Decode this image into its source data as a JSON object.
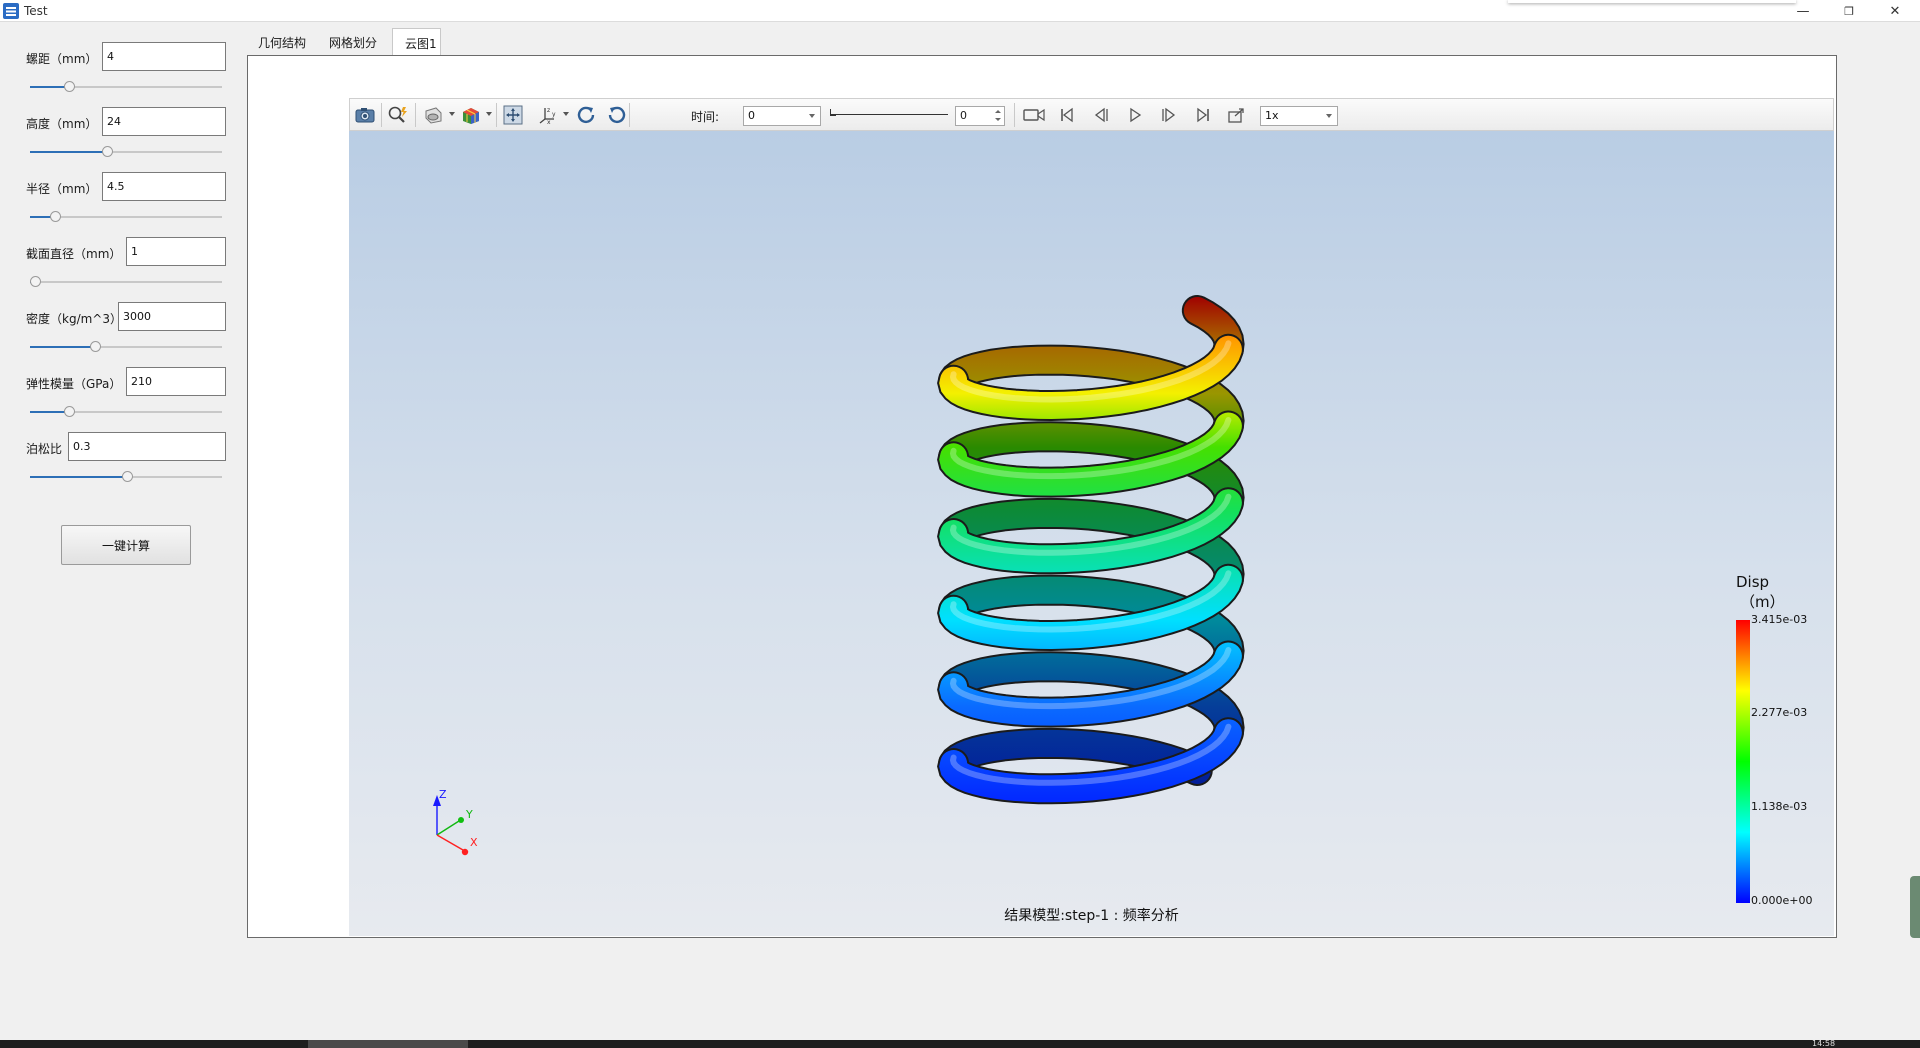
{
  "window": {
    "title": "Test",
    "minimize": "—",
    "restore": "❐",
    "close": "✕"
  },
  "params": [
    {
      "label": "螺距（mm）",
      "value": "4",
      "slider_pct": 0.19
    },
    {
      "label": "高度（mm）",
      "value": "24",
      "slider_pct": 0.4
    },
    {
      "label": "半径（mm）",
      "value": "4.5",
      "slider_pct": 0.11
    },
    {
      "label": "截面直径（mm）",
      "value": "1",
      "slider_pct": 0.0
    },
    {
      "label": "密度（kg/m^3）",
      "value": "3000",
      "slider_pct": 0.33
    },
    {
      "label": "弹性模量（GPa）",
      "value": "210",
      "slider_pct": 0.19
    },
    {
      "label": "泊松比",
      "value": "0.3",
      "slider_pct": 0.51
    }
  ],
  "calc_button": "一键计算",
  "tabs": [
    {
      "label": "几何结构",
      "active": false
    },
    {
      "label": "网格划分",
      "active": false
    },
    {
      "label": "云图1",
      "active": true
    }
  ],
  "toolbar": {
    "time_label": "时间:",
    "time_combo": "0",
    "time_spin": "0",
    "speed_combo": "1x"
  },
  "viewport": {
    "status": "结果模型:step-1 : 频率分析",
    "axes": {
      "z": "Z",
      "y": "Y",
      "x": "X"
    }
  },
  "colorbar": {
    "title": "Disp",
    "unit": "（m）",
    "ticks": [
      "3.415e-03",
      "2.277e-03",
      "1.138e-03",
      "0.000e+00"
    ],
    "colors": [
      "#ff0000",
      "#ffff00",
      "#00ff00",
      "#00ffff",
      "#0000ff"
    ]
  },
  "taskbar": {
    "clock": "14:58"
  }
}
